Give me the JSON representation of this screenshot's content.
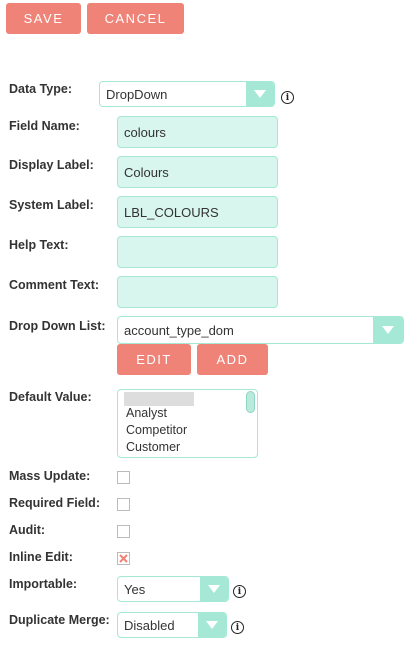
{
  "toolbar": {
    "save_label": "SAVE",
    "cancel_label": "CANCEL"
  },
  "form": {
    "data_type": {
      "label": "Data Type:",
      "value": "DropDown"
    },
    "field_name": {
      "label": "Field Name:",
      "value": "colours"
    },
    "display_label": {
      "label": "Display Label:",
      "value": "Colours"
    },
    "system_label": {
      "label": "System Label:",
      "value": "LBL_COLOURS"
    },
    "help_text": {
      "label": "Help Text:",
      "value": ""
    },
    "comment_text": {
      "label": "Comment Text:",
      "value": ""
    },
    "drop_down_list": {
      "label": "Drop Down List:",
      "value": "account_type_dom",
      "edit_label": "EDIT",
      "add_label": "ADD"
    },
    "default_value": {
      "label": "Default Value:",
      "options": [
        "",
        "Analyst",
        "Competitor",
        "Customer"
      ]
    },
    "mass_update": {
      "label": "Mass Update:",
      "checked": false
    },
    "required_field": {
      "label": "Required Field:",
      "checked": false
    },
    "audit": {
      "label": "Audit:",
      "checked": false
    },
    "inline_edit": {
      "label": "Inline Edit:",
      "checked": true
    },
    "importable": {
      "label": "Importable:",
      "value": "Yes"
    },
    "duplicate_merge": {
      "label": "Duplicate Merge:",
      "value": "Disabled"
    }
  },
  "info_glyph": "i",
  "colors": {
    "accent_button": "#f08377",
    "field_bg": "#d8f5ee",
    "field_border": "#a5e8d6"
  }
}
